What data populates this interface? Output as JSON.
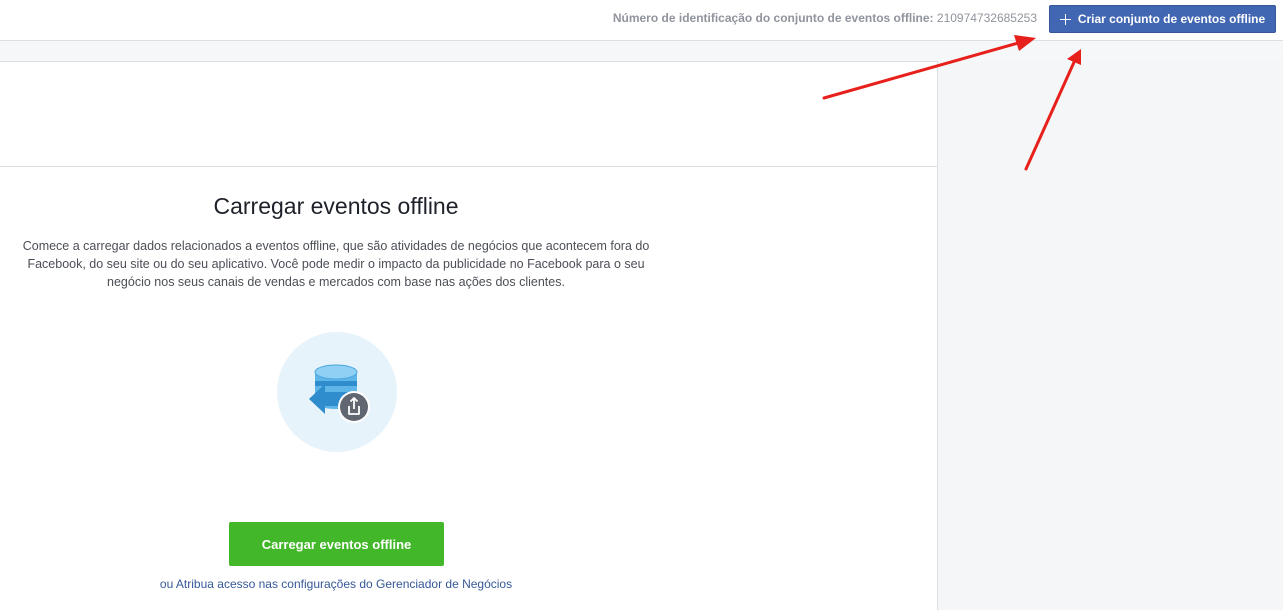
{
  "topbar": {
    "event_id_label": "Número de identificação do conjunto de eventos offline:",
    "event_id_value": "210974732685253",
    "create_button_label": "Criar conjunto de eventos offline"
  },
  "main": {
    "title": "Carregar eventos offline",
    "description": "Comece a carregar dados relacionados a eventos offline, que são atividades de negócios que acontecem fora do Facebook, do seu site ou do seu aplicativo. Você pode medir o impacto da publicidade no Facebook para o seu negócio nos seus canais de vendas e mercados com base nas ações dos clientes.",
    "upload_button_label": "Carregar eventos offline",
    "business_manager_link": "ou Atribua acesso nas configurações do Gerenciador de Negócios"
  },
  "icons": {
    "plus": "plus-icon",
    "illustration": "database-upload-icon"
  },
  "colors": {
    "create_button": "#4267b2",
    "upload_button": "#42b72a",
    "link": "#365899",
    "annotation_arrows": "#e8201b"
  }
}
